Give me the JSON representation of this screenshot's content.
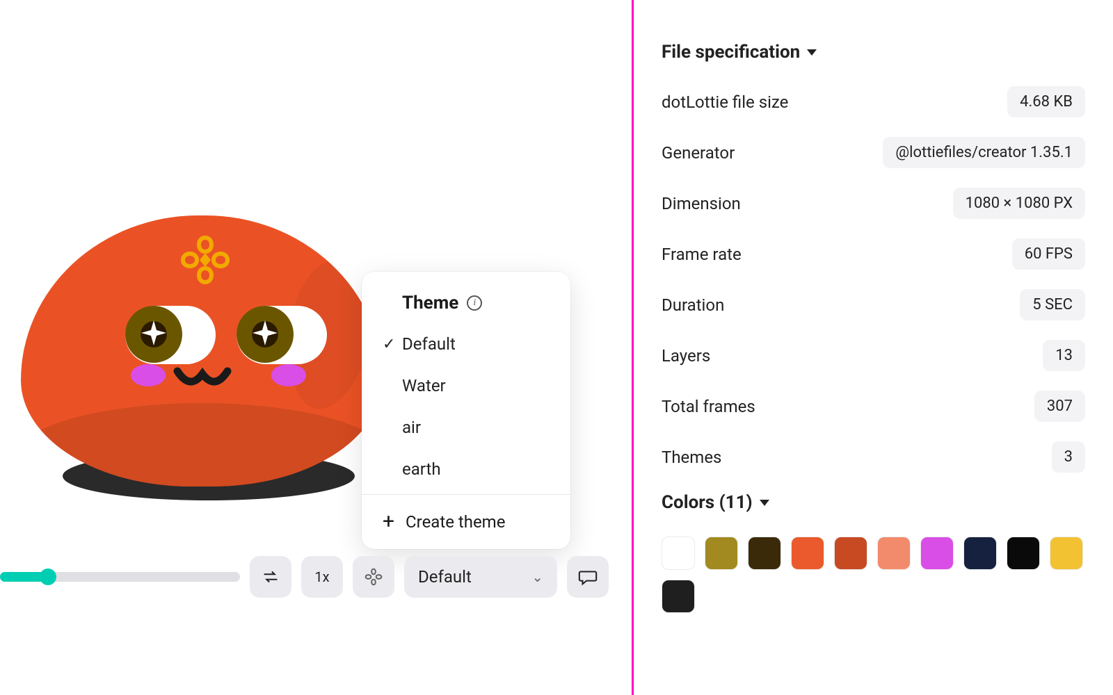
{
  "sections": {
    "file_spec": {
      "title": "File specification",
      "rows": {
        "size": {
          "label": "dotLottie file size",
          "value": "4.68 KB"
        },
        "generator": {
          "label": "Generator",
          "value": "@lottiefiles/creator 1.35.1"
        },
        "dimension": {
          "label": "Dimension",
          "value": "1080 × 1080 PX"
        },
        "framerate": {
          "label": "Frame rate",
          "value": "60 FPS"
        },
        "duration": {
          "label": "Duration",
          "value": "5 SEC"
        },
        "layers": {
          "label": "Layers",
          "value": "13"
        },
        "frames": {
          "label": "Total frames",
          "value": "307"
        },
        "themes": {
          "label": "Themes",
          "value": "3"
        }
      }
    },
    "colors": {
      "title": "Colors (11)",
      "swatches": [
        "#ffffff",
        "#a38a20",
        "#3a2a0a",
        "#ea5a2c",
        "#c74a22",
        "#f28b6b",
        "#d94ee6",
        "#15213f",
        "#0a0a0a",
        "#f2c233",
        "#1f1f1f"
      ]
    }
  },
  "popover": {
    "title": "Theme",
    "items": [
      {
        "label": "Default",
        "selected": true
      },
      {
        "label": "Water",
        "selected": false
      },
      {
        "label": "air",
        "selected": false
      },
      {
        "label": "earth",
        "selected": false
      }
    ],
    "create_label": "Create theme"
  },
  "toolbar": {
    "speed": "1x",
    "theme_selected": "Default"
  }
}
